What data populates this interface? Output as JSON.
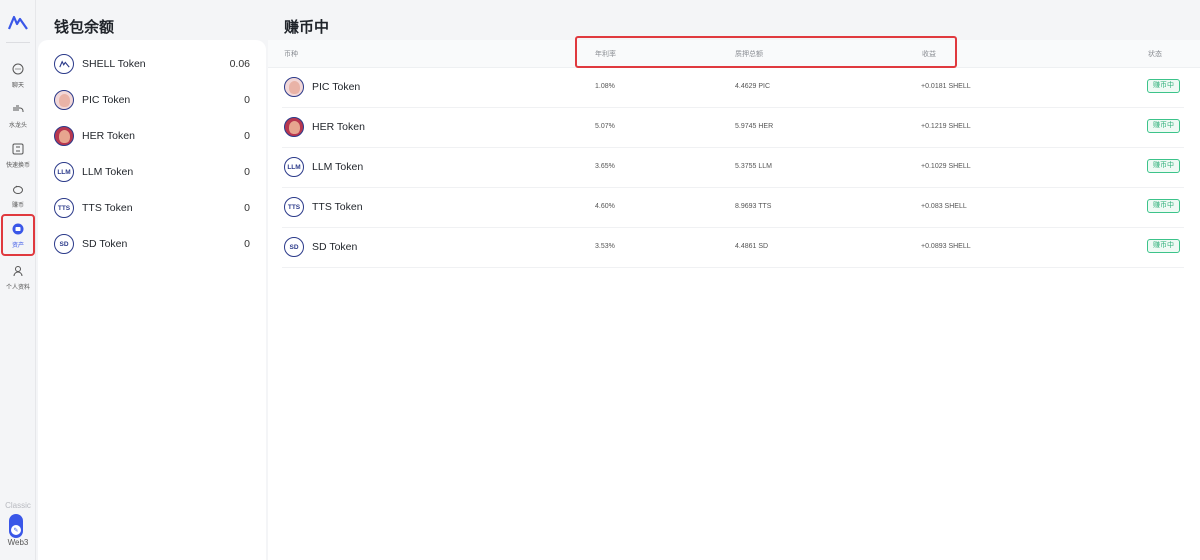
{
  "rail": {
    "items": [
      {
        "label": "聊天",
        "icon": "chat-bubble-icon"
      },
      {
        "label": "水龙头",
        "icon": "faucet-icon"
      },
      {
        "label": "快速换币",
        "icon": "swap-icon"
      },
      {
        "label": "赚币",
        "icon": "piggy-bank-icon"
      },
      {
        "label": "资产",
        "icon": "wallet-icon"
      },
      {
        "label": "个人资料",
        "icon": "user-icon"
      }
    ],
    "classic_label": "Classic",
    "web3_label": "Web3",
    "accent": "#3a57e8"
  },
  "wallet": {
    "title": "钱包余额",
    "tokens": [
      {
        "name": "SHELL Token",
        "amount": "0.06",
        "icon": "shell-coin-icon"
      },
      {
        "name": "PIC Token",
        "amount": "0",
        "icon": "pic-coin-icon"
      },
      {
        "name": "HER Token",
        "amount": "0",
        "icon": "her-coin-icon"
      },
      {
        "name": "LLM Token",
        "amount": "0",
        "icon": "llm-coin-icon",
        "code": "LLM"
      },
      {
        "name": "TTS Token",
        "amount": "0",
        "icon": "tts-coin-icon",
        "code": "TTS"
      },
      {
        "name": "SD Token",
        "amount": "0",
        "icon": "sd-coin-icon",
        "code": "SD"
      }
    ]
  },
  "earning": {
    "title": "赚币中",
    "columns": {
      "coin": "币种",
      "apr": "年利率",
      "staked": "质押总额",
      "earnings": "收益",
      "status": "状态"
    },
    "rows": [
      {
        "name": "PIC Token",
        "apr": "1.08%",
        "staked": "4.4629 PIC",
        "earnings": "+0.0181 SHELL",
        "status": "赚币中",
        "icon": "pic-coin-icon"
      },
      {
        "name": "HER Token",
        "apr": "5.07%",
        "staked": "5.9745 HER",
        "earnings": "+0.1219 SHELL",
        "status": "赚币中",
        "icon": "her-coin-icon"
      },
      {
        "name": "LLM Token",
        "apr": "3.65%",
        "staked": "5.3755 LLM",
        "earnings": "+0.1029 SHELL",
        "status": "赚币中",
        "icon": "llm-coin-icon",
        "code": "LLM"
      },
      {
        "name": "TTS Token",
        "apr": "4.60%",
        "staked": "8.9693 TTS",
        "earnings": "+0.083 SHELL",
        "status": "赚币中",
        "icon": "tts-coin-icon",
        "code": "TTS"
      },
      {
        "name": "SD Token",
        "apr": "3.53%",
        "staked": "4.4861 SD",
        "earnings": "+0.0893 SHELL",
        "status": "赚币中",
        "icon": "sd-coin-icon",
        "code": "SD"
      }
    ],
    "status_color": "#2fb07a",
    "highlight_color": "#e0393e"
  }
}
